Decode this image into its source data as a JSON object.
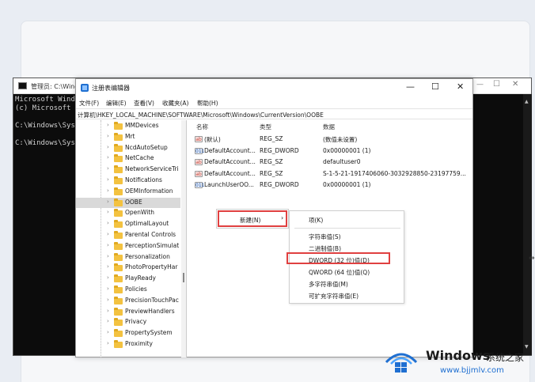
{
  "cmd": {
    "title": "管理员: C:\\Wind",
    "lines": [
      "Microsoft Windo",
      "(c) Microsoft C",
      "C:\\Windows\\Syst",
      "C:\\Windows\\Syst"
    ],
    "min": "—",
    "max": "☐",
    "close": "✕"
  },
  "regedit": {
    "title": "注册表编辑器",
    "min": "—",
    "max": "☐",
    "close": "✕",
    "menu": [
      "文件(F)",
      "编辑(E)",
      "查看(V)",
      "收藏夹(A)",
      "帮助(H)"
    ],
    "address": "计算机\\HKEY_LOCAL_MACHINE\\SOFTWARE\\Microsoft\\Windows\\CurrentVersion\\OOBE",
    "tree": [
      "MMDevices",
      "Mrt",
      "NcdAutoSetup",
      "NetCache",
      "NetworkServiceTri",
      "Notifications",
      "OEMInformation",
      "OOBE",
      "OpenWith",
      "OptimalLayout",
      "Parental Controls",
      "PerceptionSimulat",
      "Personalization",
      "PhotoPropertyHar",
      "PlayReady",
      "Policies",
      "PrecisionTouchPac",
      "PreviewHandlers",
      "Privacy",
      "PropertySystem",
      "Proximity"
    ],
    "selected_tree_item": "OOBE",
    "columns": {
      "name": "名称",
      "type": "类型",
      "data": "数据"
    },
    "values": [
      {
        "icon": "ab",
        "name": "(默认)",
        "type": "REG_SZ",
        "data": "(数值未设置)"
      },
      {
        "icon": "011",
        "name": "DefaultAccount...",
        "type": "REG_DWORD",
        "data": "0x00000001 (1)"
      },
      {
        "icon": "ab",
        "name": "DefaultAccount...",
        "type": "REG_SZ",
        "data": "defaultuser0"
      },
      {
        "icon": "ab",
        "name": "DefaultAccount...",
        "type": "REG_SZ",
        "data": "S-1-5-21-1917406060-3032928850-23197759..."
      },
      {
        "icon": "011",
        "name": "LaunchUserOO...",
        "type": "REG_DWORD",
        "data": "0x00000001 (1)"
      }
    ]
  },
  "context_menu": {
    "new_label": "新建(N)",
    "new_arrow": "›",
    "submenu": [
      "项(K)",
      "字符串值(S)",
      "二进制值(B)",
      "DWORD (32 位)值(D)",
      "QWORD (64 位)值(Q)",
      "多字符串值(M)",
      "可扩充字符串值(E)"
    ],
    "highlighted": "DWORD (32 位)值(D)"
  },
  "watermark": {
    "brand": "Windows",
    "brand_cn": "系统之家",
    "url": "www.bjjmlv.com"
  },
  "colors": {
    "highlight_border": "#e04040",
    "logo_blue": "#1f6fd1"
  }
}
